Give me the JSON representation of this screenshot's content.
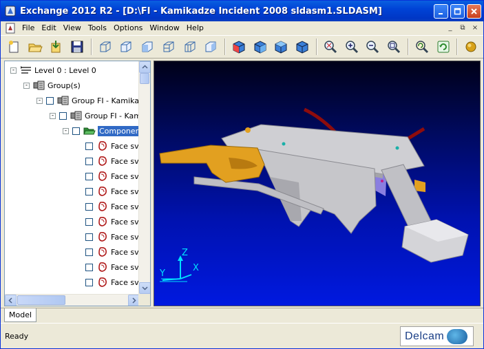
{
  "window": {
    "title": "Exchange 2012 R2 - [D:\\FI - Kamikadze Incident 2008 sldasm1.SLDASM]",
    "controls": {
      "minimize": "_",
      "maximize": "□",
      "close": "×"
    }
  },
  "menu": {
    "items": [
      "File",
      "Edit",
      "View",
      "Tools",
      "Options",
      "Window",
      "Help"
    ],
    "mdi_controls": [
      "_",
      "⧉",
      "×"
    ]
  },
  "toolbar": {
    "tools": [
      "new",
      "open",
      "import",
      "save",
      "view-iso-1",
      "view-iso-2",
      "view-iso-3",
      "view-iso-4",
      "view-iso-5",
      "view-iso-6",
      "shade-1",
      "shade-2",
      "shade-3",
      "shade-4",
      "zoom-all",
      "zoom-in",
      "zoom-out",
      "zoom-window",
      "undo-view",
      "refresh",
      "sphere"
    ]
  },
  "tree": {
    "rows": [
      {
        "label": "Level 0 : Level 0",
        "icon": "level-icon",
        "expand": "-",
        "checkbox": false,
        "indent": 0
      },
      {
        "label": "Group(s)",
        "icon": "group-icon",
        "expand": "-",
        "checkbox": false,
        "indent": 1
      },
      {
        "label": "Group FI - Kamikadz",
        "icon": "group-icon",
        "expand": "-",
        "checkbox": true,
        "indent": 2
      },
      {
        "label": "Group FI - Kami",
        "icon": "group-icon",
        "expand": "-",
        "checkbox": true,
        "indent": 3
      },
      {
        "label": "Component",
        "icon": "folder-open-icon",
        "expand": "-",
        "checkbox": true,
        "indent": 4,
        "selected": true
      },
      {
        "label": "Face sv",
        "icon": "face-icon",
        "checkbox": true,
        "indent": 5
      },
      {
        "label": "Face sv",
        "icon": "face-icon",
        "checkbox": true,
        "indent": 5
      },
      {
        "label": "Face sv",
        "icon": "face-icon",
        "checkbox": true,
        "indent": 5
      },
      {
        "label": "Face sv",
        "icon": "face-icon",
        "checkbox": true,
        "indent": 5
      },
      {
        "label": "Face sv",
        "icon": "face-icon",
        "checkbox": true,
        "indent": 5
      },
      {
        "label": "Face sv",
        "icon": "face-icon",
        "checkbox": true,
        "indent": 5
      },
      {
        "label": "Face sv",
        "icon": "face-icon",
        "checkbox": true,
        "indent": 5
      },
      {
        "label": "Face sv",
        "icon": "face-icon",
        "checkbox": true,
        "indent": 5
      },
      {
        "label": "Face sv",
        "icon": "face-icon",
        "checkbox": true,
        "indent": 5
      },
      {
        "label": "Face sv",
        "icon": "face-icon",
        "checkbox": true,
        "indent": 5
      }
    ]
  },
  "viewport": {
    "axes": {
      "z": "Z",
      "y": "Y",
      "x": "X"
    },
    "colors": {
      "axis": "#00e0ff",
      "gold": "#e0a020",
      "grey": "#c8c8cc",
      "red": "#a01010"
    }
  },
  "tabs": {
    "model": "Model"
  },
  "status": {
    "text": "Ready",
    "logo": "Delcam"
  }
}
